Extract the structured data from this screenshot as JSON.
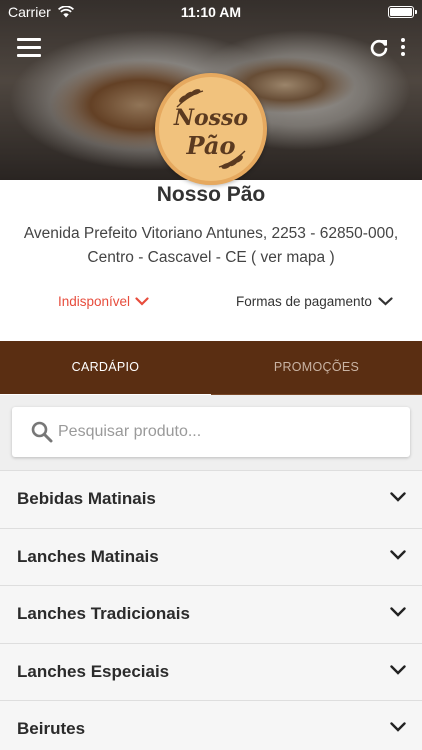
{
  "status_bar": {
    "carrier": "Carrier",
    "time": "11:10 AM"
  },
  "logo": {
    "line1": "Nosso",
    "line2": "Pão"
  },
  "store": {
    "name": "Nosso Pão",
    "address_line1": "Avenida Prefeito Vitoriano Antunes, 2253 - 62850-000,",
    "address_line2": "Centro - Cascavel - CE ( ",
    "map_link": "ver mapa",
    "address_end": " )"
  },
  "status": {
    "label": "Indisponível",
    "color": "#e74c3c"
  },
  "payment": {
    "label": "Formas de pagamento"
  },
  "tabs": [
    {
      "label": "CARDÁPIO",
      "active": true
    },
    {
      "label": "PROMOÇÕES",
      "active": false
    }
  ],
  "search": {
    "placeholder": "Pesquisar produto..."
  },
  "categories": [
    {
      "label": "Bebidas Matinais"
    },
    {
      "label": "Lanches Matinais"
    },
    {
      "label": "Lanches Tradicionais"
    },
    {
      "label": "Lanches Especiais"
    },
    {
      "label": "Beirutes"
    }
  ],
  "colors": {
    "tab_bar": "#5a2e12",
    "accent_red": "#e74c3c",
    "logo_bg": "#f1c27d"
  },
  "icons": [
    "menu-icon",
    "refresh-icon",
    "more-vertical-icon",
    "search-icon",
    "chevron-down-icon",
    "wifi-icon",
    "battery-icon"
  ]
}
